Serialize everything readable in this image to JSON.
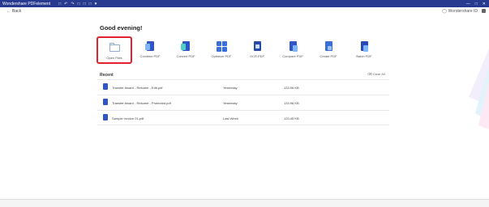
{
  "window": {
    "title": "Wondershare PDFelement",
    "toolbar_icons": [
      "□",
      "↶",
      "↷",
      "□",
      "□",
      "□",
      "♥"
    ],
    "controls": [
      "—",
      "□",
      "✕"
    ]
  },
  "topbar": {
    "back_label": "Back",
    "account_label": "Wondershare ID"
  },
  "greeting": "Good evening!",
  "tools": [
    {
      "label": "Open Files",
      "icon": "folder-icon"
    },
    {
      "label": "Combine PDF",
      "icon": "combine-pdf-icon"
    },
    {
      "label": "Convert PDF",
      "icon": "convert-pdf-icon"
    },
    {
      "label": "Optimize PDF",
      "icon": "optimize-pdf-icon"
    },
    {
      "label": "OCR PDF",
      "icon": "ocr-pdf-icon"
    },
    {
      "label": "Compare PDF",
      "icon": "compare-pdf-icon"
    },
    {
      "label": "Create PDF",
      "icon": "create-pdf-icon"
    },
    {
      "label": "Batch PDF",
      "icon": "batch-pdf-icon"
    }
  ],
  "recent": {
    "title": "Recent",
    "clear_label": "Clear All",
    "files": [
      {
        "name": "Transfer Award - Resume - Edit.pdf",
        "date": "Yesterday",
        "size": "133.96 KB"
      },
      {
        "name": "Transfer Award - Resume - Protected.pdf",
        "date": "Yesterday",
        "size": "133.96 KB"
      },
      {
        "name": "Sample invoice 01.pdf",
        "date": "Last Week",
        "size": "120.45 KB"
      }
    ]
  },
  "colors": {
    "titlebar": "#283a8f",
    "accent": "#2f55c7",
    "highlight": "#e0232e"
  }
}
